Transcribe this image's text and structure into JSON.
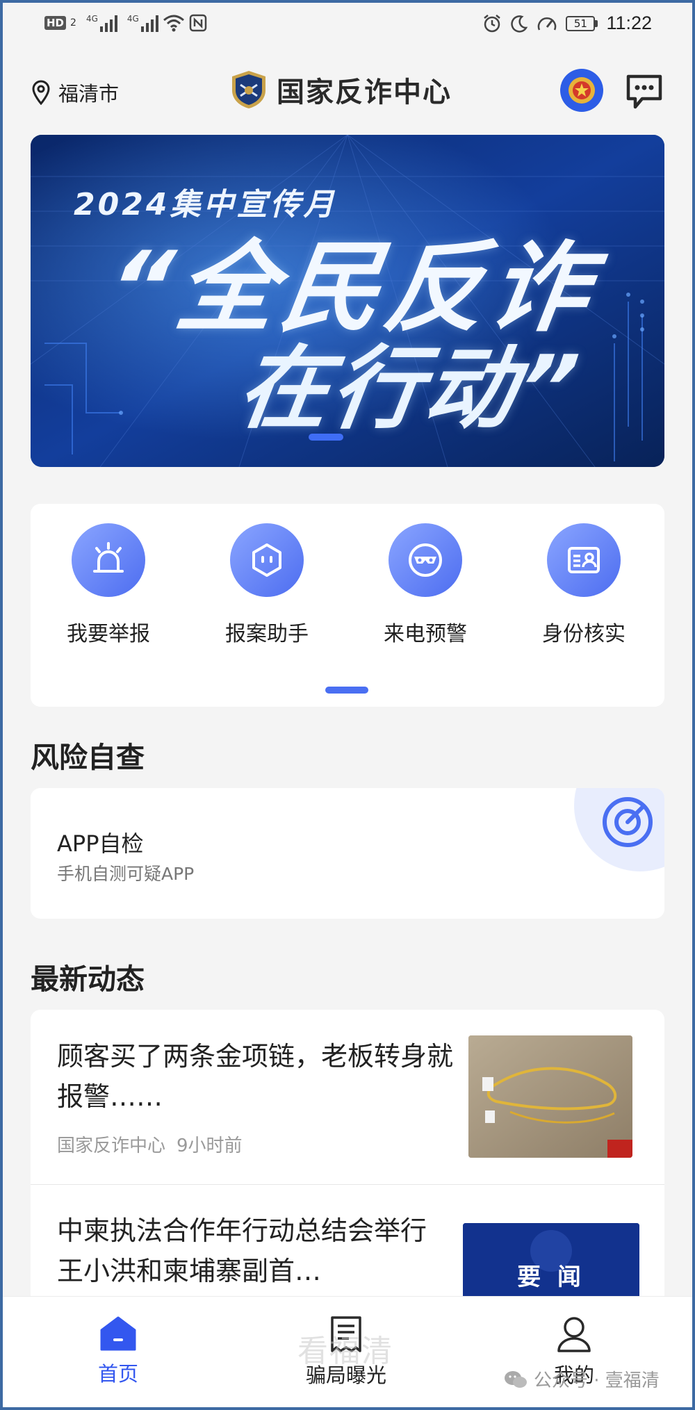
{
  "status_bar": {
    "hd_label": "HD",
    "sim1": "2",
    "net1": "4G",
    "net2": "4G",
    "battery": "51",
    "time": "11:22"
  },
  "header": {
    "location": "福清市",
    "app_title": "国家反诈中心"
  },
  "banner": {
    "subtitle": "2024集中宣传月",
    "line1": "“全民反诈",
    "line2": "在行动”"
  },
  "quick_actions": [
    {
      "label": "我要举报",
      "icon": "alarm-siren-icon"
    },
    {
      "label": "报案助手",
      "icon": "robot-assistant-icon"
    },
    {
      "label": "来电预警",
      "icon": "mask-call-warning-icon"
    },
    {
      "label": "身份核实",
      "icon": "id-card-icon"
    }
  ],
  "risk": {
    "section_title": "风险自查",
    "card_title": "APP自检",
    "card_desc": "手机自测可疑APP"
  },
  "news": {
    "section_title": "最新动态",
    "items": [
      {
        "title": "顾客买了两条金项链，老板转身就报警……",
        "source": "国家反诈中心",
        "time": "9小时前"
      },
      {
        "title": "中柬执法合作年行动总结会举行　王小洪和柬埔寨副首…",
        "thumb_text": "要 闻"
      }
    ]
  },
  "tabbar": {
    "items": [
      {
        "label": "首页",
        "active": true
      },
      {
        "label": "骗局曝光",
        "active": false
      },
      {
        "label": "我的",
        "active": false
      }
    ]
  },
  "watermark": {
    "text": "公众号 · 壹福清",
    "ghost": "看福清"
  },
  "colors": {
    "accent": "#3357ef",
    "banner_bg": "#0b2a6e",
    "icon_gradient_start": "#8aa5ff",
    "icon_gradient_end": "#4d6df0"
  }
}
